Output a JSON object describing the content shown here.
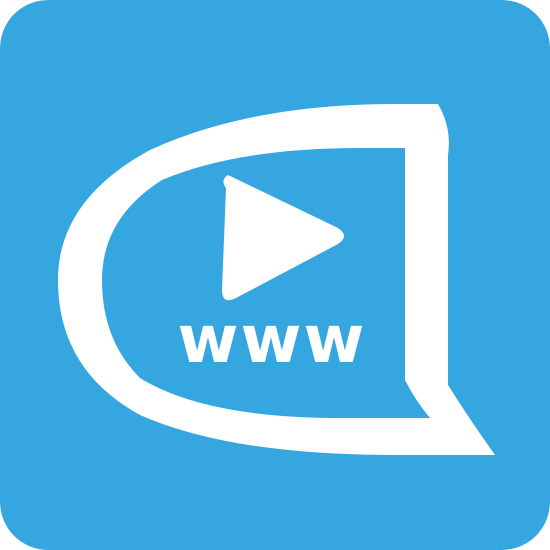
{
  "app_icon": {
    "logo_text": "www",
    "icon": "video-speech-bubble-icon",
    "play_icon": "play-icon",
    "colors": {
      "background": "#36A6E0",
      "foreground": "#FFFFFF"
    }
  }
}
